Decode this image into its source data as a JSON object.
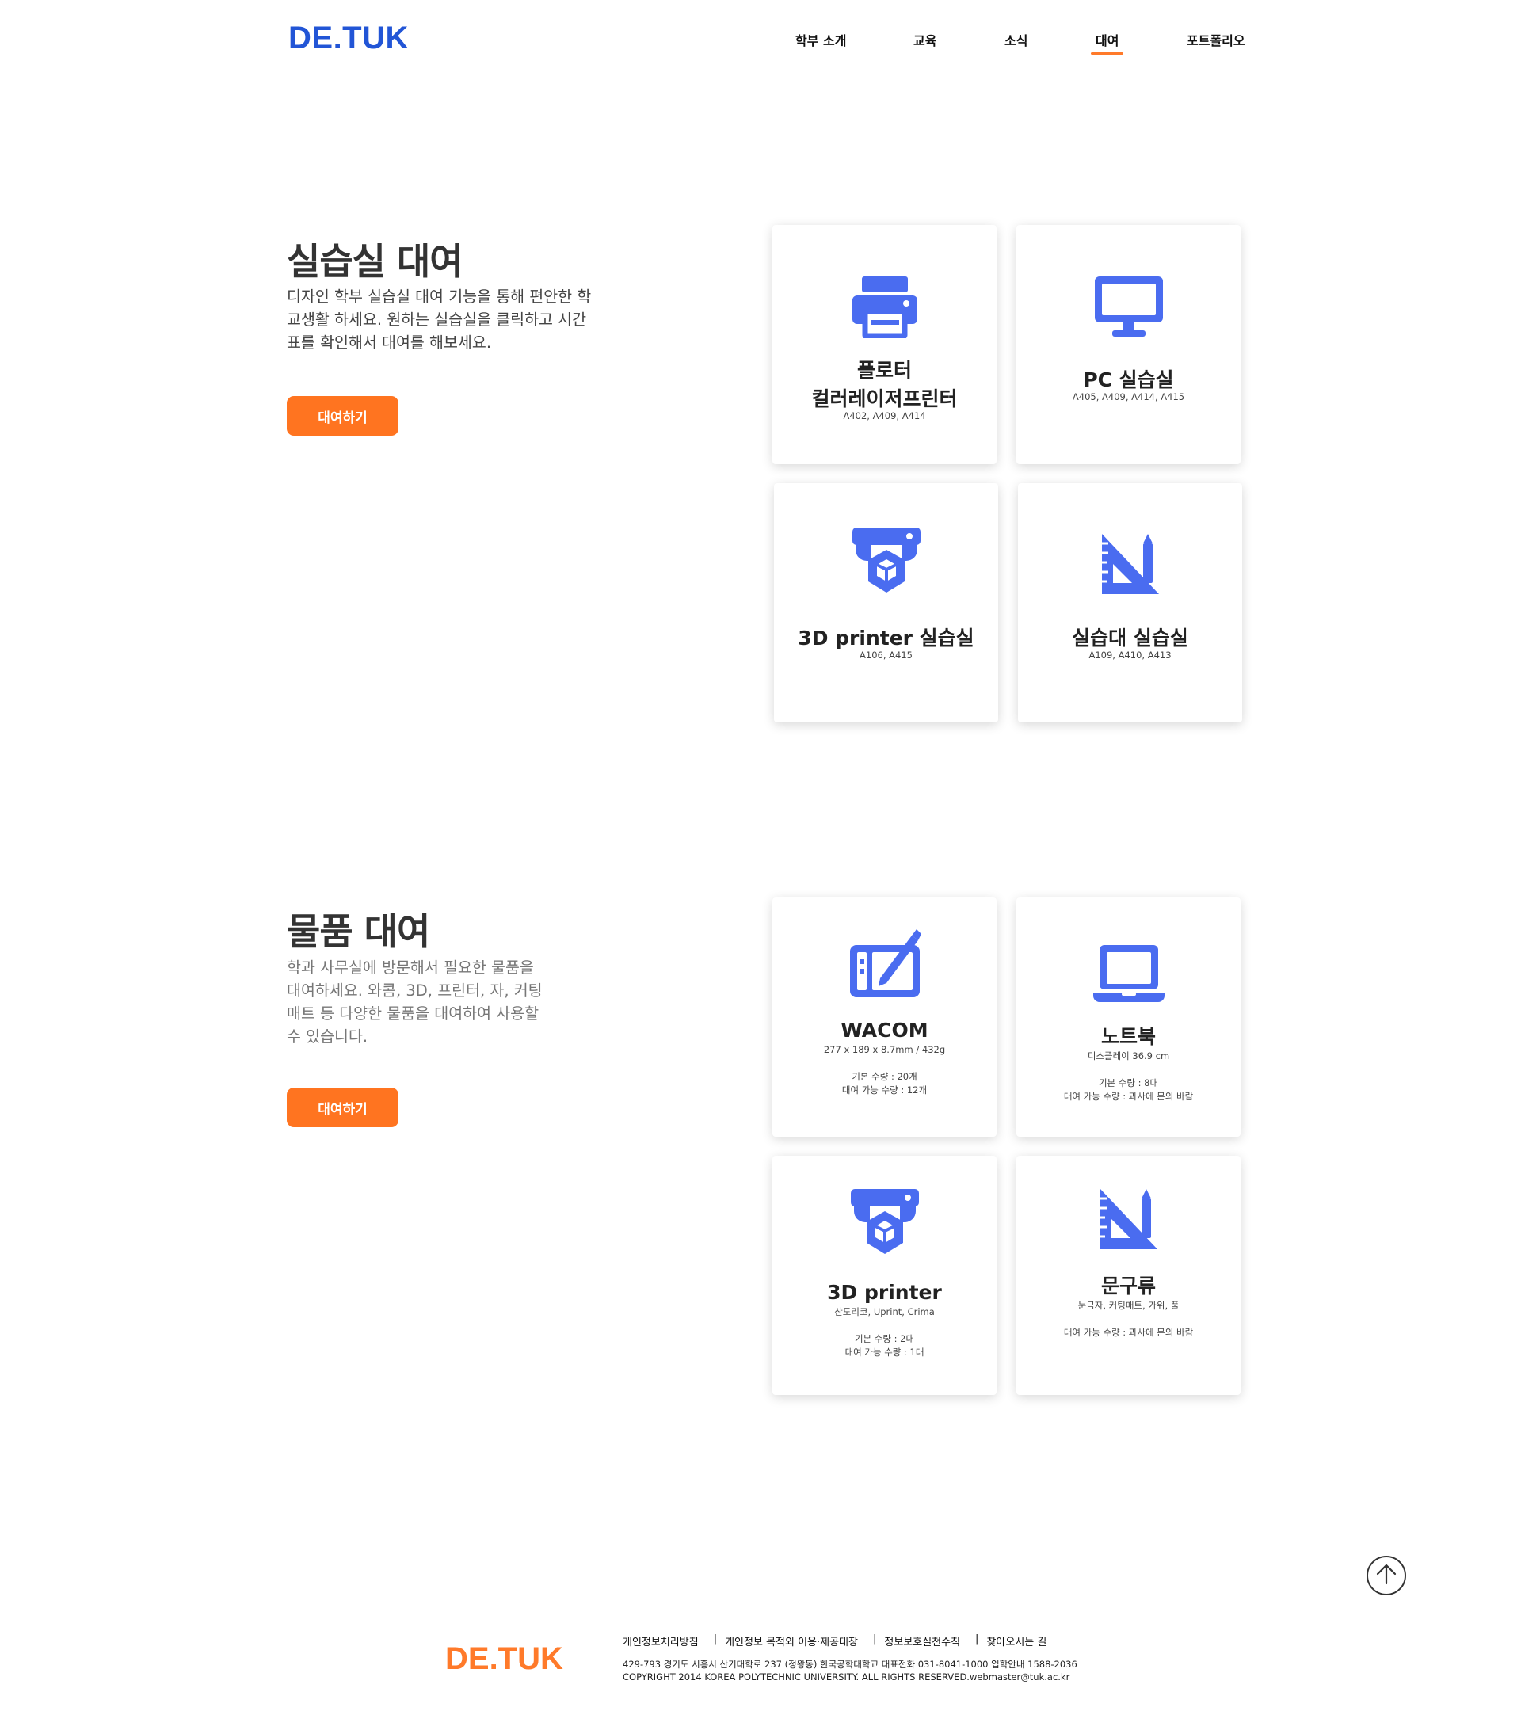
{
  "header": {
    "logo": "DE.TUK",
    "nav": [
      {
        "label": "학부 소개"
      },
      {
        "label": "교육"
      },
      {
        "label": "소식"
      },
      {
        "label": "대여",
        "active": true
      },
      {
        "label": "포트폴리오"
      }
    ]
  },
  "colors": {
    "brand_blue": "#2255d6",
    "icon_blue": "#4a6cf0",
    "accent_orange": "#ff7420"
  },
  "room_section": {
    "title": "실습실 대여",
    "desc_lines": [
      "디자인 학부 실습실 대여 기능을 통해 편안한 학",
      "교생활 하세요. 원하는 실습실을 클릭하고 시간",
      "표를 확인해서 대여를 해보세요."
    ],
    "button": "대여하기",
    "cards": [
      {
        "icon": "printer-icon",
        "title_lines": [
          "플로터",
          "컬러레이저프린터"
        ],
        "sub_lines": [
          "A402, A409, A414"
        ]
      },
      {
        "icon": "monitor-icon",
        "title_lines": [
          "PC 실습실"
        ],
        "sub_lines": [
          "A405, A409, A414, A415"
        ]
      },
      {
        "icon": "3d-printer-icon",
        "title_lines": [
          "3D printer 실습실"
        ],
        "sub_lines": [
          "A106, A415"
        ]
      },
      {
        "icon": "drafting-tools-icon",
        "title_lines": [
          "실습대 실습실"
        ],
        "sub_lines": [
          "A109, A410, A413"
        ]
      }
    ]
  },
  "item_section": {
    "title": "물품 대여",
    "desc_lines": [
      "학과 사무실에 방문해서 필요한 물품을",
      "대여하세요. 와콤, 3D, 프린터, 자, 커팅",
      "매트 등 다양한 물품을 대여하여 사용할",
      "수 있습니다."
    ],
    "button": "대여하기",
    "cards": [
      {
        "icon": "drawing-tablet-icon",
        "title_lines": [
          "WACOM"
        ],
        "sub_lines": [
          "277 x 189 x 8.7mm / 432g",
          "",
          "기본 수량 : 20개",
          "대여 가능 수량 : 12개"
        ]
      },
      {
        "icon": "laptop-icon",
        "title_lines": [
          "노트북"
        ],
        "sub_lines": [
          "디스플레이 36.9 cm",
          "",
          "기본 수량 : 8대",
          "대여 가능 수량 : 과사에 문의 바람"
        ]
      },
      {
        "icon": "3d-printer-icon",
        "title_lines": [
          "3D printer"
        ],
        "sub_lines": [
          "산도리코, Uprint, Crima",
          "",
          "기본 수량 : 2대",
          "대여 가능 수량 : 1대"
        ]
      },
      {
        "icon": "drafting-tools-icon",
        "title_lines": [
          "문구류"
        ],
        "sub_lines": [
          "눈금자, 커팅매트, 가위, 풀",
          "",
          "대여 가능 수량 : 과사에 문의 바람"
        ]
      }
    ]
  },
  "footer": {
    "logo": "DE.TUK",
    "links": [
      "개인정보처리방침",
      "개인정보 목적외 이용·제공대장",
      "정보보호실천수칙",
      "찾아오시는 길"
    ],
    "separator": "|",
    "address": "429-793 경기도 시흥시 산기대학로 237 (정왕동) 한국공학대학교 대표전화 031-8041-1000 입학안내 1588-2036",
    "copyright": "COPYRIGHT 2014 KOREA POLYTECHNIC UNIVERSITY. ALL RIGHTS RESERVED.webmaster@tuk.ac.kr"
  }
}
